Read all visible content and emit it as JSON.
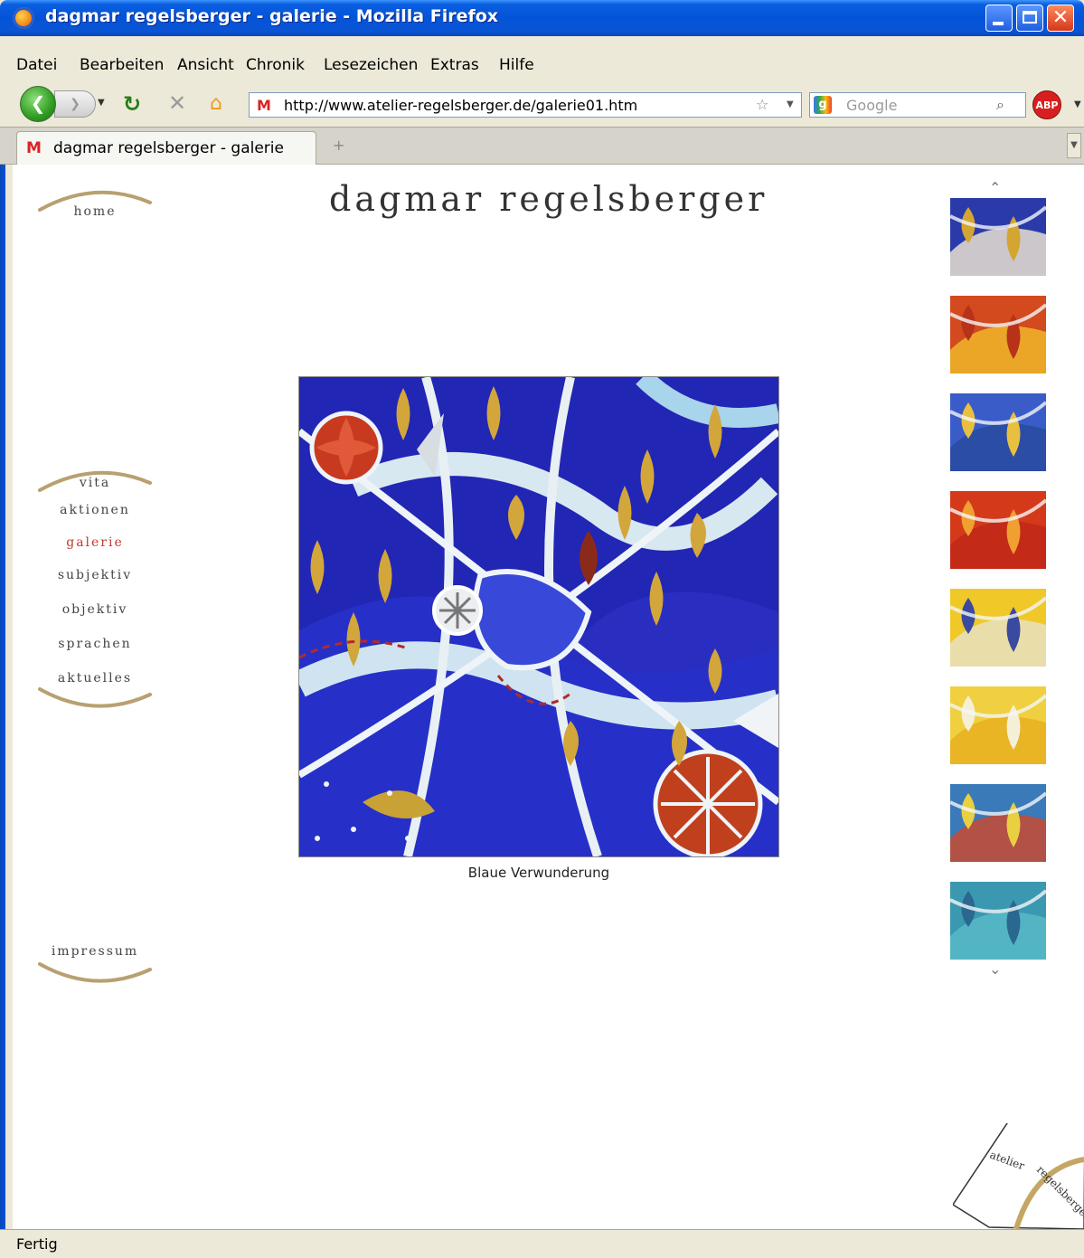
{
  "window": {
    "title": "dagmar regelsberger - galerie - Mozilla Firefox",
    "close_label": "✕"
  },
  "menu": [
    "Datei",
    "Bearbeiten",
    "Ansicht",
    "Chronik",
    "Lesezeichen",
    "Extras",
    "Hilfe"
  ],
  "nav": {
    "back_label": "❮",
    "fwd_label": "❯",
    "url": "http://www.atelier-regelsberger.de/galerie01.htm",
    "search_placeholder": "Google",
    "abp_label": "ABP"
  },
  "tabs": [
    {
      "label": "dagmar regelsberger - galerie"
    }
  ],
  "site": {
    "title": "dagmar regelsberger",
    "home_label": "home",
    "menu": [
      {
        "label": "vita",
        "active": false
      },
      {
        "label": "aktionen",
        "active": false
      },
      {
        "label": "galerie",
        "active": true
      },
      {
        "label": "subjektiv",
        "active": false
      },
      {
        "label": "objektiv",
        "active": false
      },
      {
        "label": "sprachen",
        "active": false
      },
      {
        "label": "aktuelles",
        "active": false
      }
    ],
    "impressum_label": "impressum",
    "artwork_caption": "Blaue Verwunderung",
    "card_text": "atelier",
    "card_text2": "regelsberger"
  },
  "thumbnails": [
    {
      "name": "thumb-1",
      "colors": [
        "#2a3aa8",
        "#e8e0d0",
        "#d4a530"
      ]
    },
    {
      "name": "thumb-2",
      "colors": [
        "#d24a1e",
        "#f0b62a",
        "#b8321a"
      ]
    },
    {
      "name": "thumb-3",
      "colors": [
        "#3a5cc8",
        "#2a4aa0",
        "#e8c040"
      ]
    },
    {
      "name": "thumb-4",
      "colors": [
        "#d43a1a",
        "#c02818",
        "#f0a030"
      ]
    },
    {
      "name": "thumb-5",
      "colors": [
        "#f0c828",
        "#e8e0c0",
        "#3a4aa0"
      ]
    },
    {
      "name": "thumb-6",
      "colors": [
        "#f0d040",
        "#e8b020",
        "#f4f0d8"
      ]
    },
    {
      "name": "thumb-7",
      "colors": [
        "#3a7ab8",
        "#c84a30",
        "#e8d040"
      ]
    },
    {
      "name": "thumb-8",
      "colors": [
        "#3a98b0",
        "#58b8c8",
        "#2a6890"
      ]
    }
  ],
  "status": "Fertig",
  "accent_colors": {
    "xp_blue": "#0453d8",
    "active_link": "#c0392b",
    "gold": "#b8a070"
  }
}
